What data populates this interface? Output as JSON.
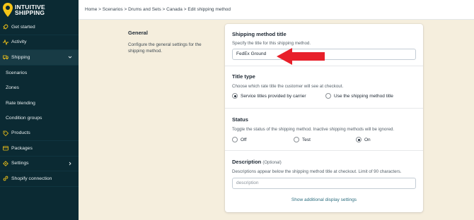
{
  "brand": {
    "line1": "INTUITIVE",
    "line2": "SHIPPING",
    "logo_icon": "location-pin-icon",
    "accent_color": "#f5c518"
  },
  "sidebar": {
    "items": [
      {
        "label": "Get started",
        "icon": "rocket-icon"
      },
      {
        "label": "Activity",
        "icon": "pulse-icon"
      },
      {
        "label": "Shipping",
        "icon": "truck-icon",
        "expanded": true
      },
      {
        "label": "Scenarios"
      },
      {
        "label": "Zones"
      },
      {
        "label": "Rate blending"
      },
      {
        "label": "Condition groups"
      },
      {
        "label": "Products",
        "icon": "tag-icon"
      },
      {
        "label": "Packages",
        "icon": "package-icon"
      },
      {
        "label": "Settings",
        "icon": "gear-icon"
      },
      {
        "label": "Shopify connection",
        "icon": "link-icon"
      }
    ]
  },
  "breadcrumb": {
    "items": [
      "Home",
      "Scenarios",
      "Drums and Sets",
      "Canada",
      "Edit shipping method"
    ],
    "separator": ">"
  },
  "general": {
    "title": "General",
    "description": "Configure the general settings for the shipping method."
  },
  "form": {
    "method_title": {
      "title": "Shipping method title",
      "description": "Specify the title for this shipping method.",
      "value": "FedEx Ground"
    },
    "title_type": {
      "title": "Title type",
      "description": "Choose which rate title the customer will see at checkout.",
      "options": [
        "Service titles provided by carrier",
        "Use the shipping method title"
      ],
      "selected": "Service titles provided by carrier"
    },
    "status": {
      "title": "Status",
      "description": "Toggle the status of the shipping method. Inactive shipping methods will be ignored.",
      "options": [
        "Off",
        "Test",
        "On"
      ],
      "selected": "On"
    },
    "description": {
      "title": "Description",
      "optional": "(Optional)",
      "description": "Descriptions appear below the shipping method title at checkout. Limit of 90 characters.",
      "placeholder": "description"
    },
    "show_more_link": "Show additional display settings"
  },
  "annotation": {
    "arrow_color": "#e8202a"
  }
}
